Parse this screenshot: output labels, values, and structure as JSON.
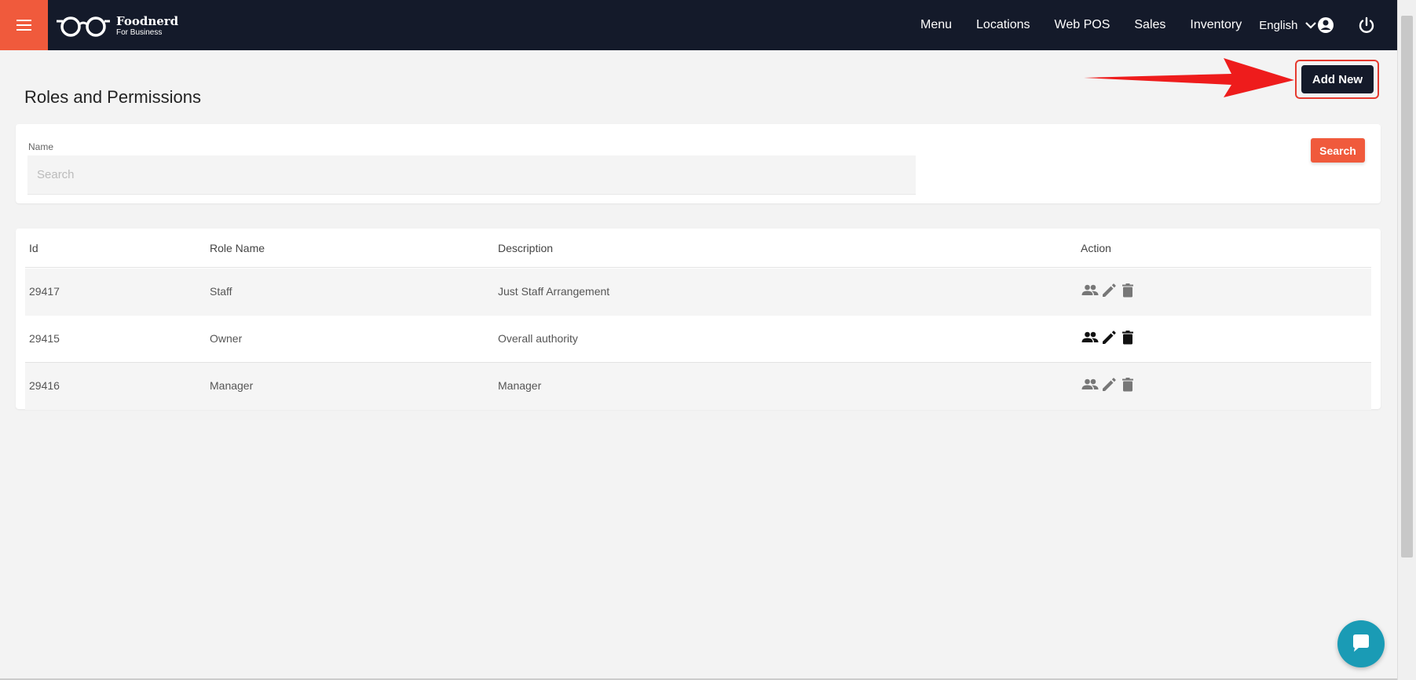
{
  "brand": {
    "name": "Foodnerd",
    "subtitle": "For Business"
  },
  "nav": {
    "items": [
      "Menu",
      "Locations",
      "Web POS",
      "Sales",
      "Inventory"
    ],
    "language": "English"
  },
  "page": {
    "title": "Roles and Permissions",
    "add_new_label": "Add New"
  },
  "search": {
    "field_label": "Name",
    "placeholder": "Search",
    "value": "",
    "button_label": "Search"
  },
  "table": {
    "headers": {
      "id": "Id",
      "role_name": "Role Name",
      "description": "Description",
      "action": "Action"
    },
    "rows": [
      {
        "id": "29417",
        "role_name": "Staff",
        "description": "Just Staff Arrangement"
      },
      {
        "id": "29415",
        "role_name": "Owner",
        "description": "Overall authority"
      },
      {
        "id": "29416",
        "role_name": "Manager",
        "description": "Manager"
      }
    ]
  },
  "colors": {
    "topbar": "#141a2a",
    "accent": "#f05a3c",
    "highlight": "#e53a2f",
    "chat": "#1a9bb5"
  },
  "icons": [
    "menu-icon",
    "glasses-logo-icon",
    "chevron-down-icon",
    "account-icon",
    "power-icon",
    "people-icon",
    "edit-icon",
    "delete-icon",
    "chat-icon"
  ]
}
